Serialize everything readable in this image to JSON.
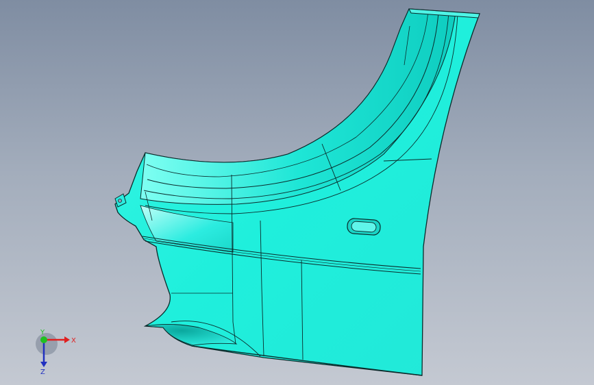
{
  "viewport": {
    "background_top": "#7f8da2",
    "background_bottom": "#c4c9d2",
    "part_color": "#23f0dd",
    "edge_color": "#0a2a2a"
  },
  "triad": {
    "x_label": "X",
    "y_label": "Y",
    "z_label": "Z",
    "x_color": "#e02020",
    "y_color": "#20c020",
    "z_color": "#2030c0"
  }
}
